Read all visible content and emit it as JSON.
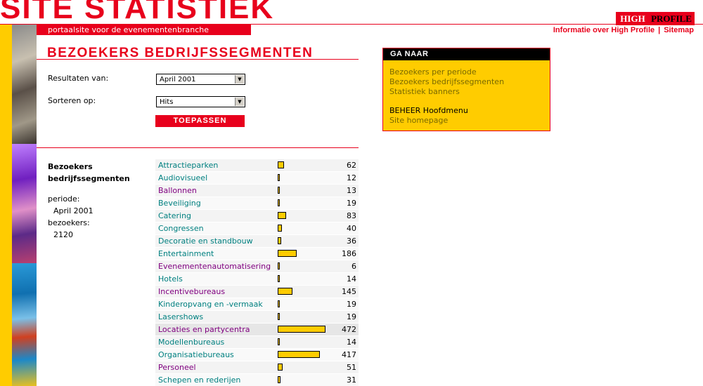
{
  "header": {
    "site_title": "SITE STATISTIEK",
    "tagline": "portaalsite voor de evenementenbranche",
    "logo_part1": "HIGH",
    "logo_part2": "PROFILE",
    "links": [
      {
        "label": "Informatie over High Profile"
      },
      {
        "label": "Sitemap"
      }
    ],
    "link_separator": "|"
  },
  "page": {
    "heading": "BEZOEKERS BEDRIJFSSEGMENTEN"
  },
  "form": {
    "results_label": "Resultaten van:",
    "results_value": "April 2001",
    "sort_label": "Sorteren op:",
    "sort_value": "Hits",
    "apply_label": "TOEPASSEN"
  },
  "summary": {
    "title_line1": "Bezoekers",
    "title_line2": "bedrijfssegmenten",
    "period_label": "periode:",
    "period_value": "April 2001",
    "visitors_label": "bezoekers:",
    "visitors_value": "2120"
  },
  "segments": [
    {
      "name": "Attractieparken",
      "count": 62,
      "color": "teal"
    },
    {
      "name": "Audiovisueel",
      "count": 12,
      "color": "teal"
    },
    {
      "name": "Ballonnen",
      "count": 13,
      "color": "purple"
    },
    {
      "name": "Beveiliging",
      "count": 19,
      "color": "teal"
    },
    {
      "name": "Catering",
      "count": 83,
      "color": "teal"
    },
    {
      "name": "Congressen",
      "count": 40,
      "color": "teal"
    },
    {
      "name": "Decoratie en standbouw",
      "count": 36,
      "color": "teal"
    },
    {
      "name": "Entertainment",
      "count": 186,
      "color": "teal"
    },
    {
      "name": "Evenementenautomatisering",
      "count": 6,
      "color": "purple"
    },
    {
      "name": "Hotels",
      "count": 14,
      "color": "teal"
    },
    {
      "name": "Incentivebureaus",
      "count": 145,
      "color": "purple"
    },
    {
      "name": "Kinderopvang en -vermaak",
      "count": 19,
      "color": "teal"
    },
    {
      "name": "Lasershows",
      "count": 19,
      "color": "teal"
    },
    {
      "name": "Locaties en partycentra",
      "count": 472,
      "color": "purple",
      "highlighted": true
    },
    {
      "name": "Modellenbureaus",
      "count": 14,
      "color": "teal"
    },
    {
      "name": "Organisatiebureaus",
      "count": 417,
      "color": "teal"
    },
    {
      "name": "Personeel",
      "count": 51,
      "color": "purple"
    },
    {
      "name": "Schepen en rederijen",
      "count": 31,
      "color": "teal"
    }
  ],
  "nav_panel": {
    "heading": "GA NAAR",
    "links": [
      {
        "label": "Bezoekers per periode"
      },
      {
        "label": "Bezoekers bedrijfssegmenten"
      },
      {
        "label": "Statistiek banners"
      }
    ],
    "admin_link": "BEHEER Hoofdmenu",
    "home_link": "Site homepage"
  },
  "colors": {
    "brand_red": "#e8001c",
    "yellow": "#ffcc00",
    "link_teal": "#008080",
    "link_purple": "#800080"
  }
}
